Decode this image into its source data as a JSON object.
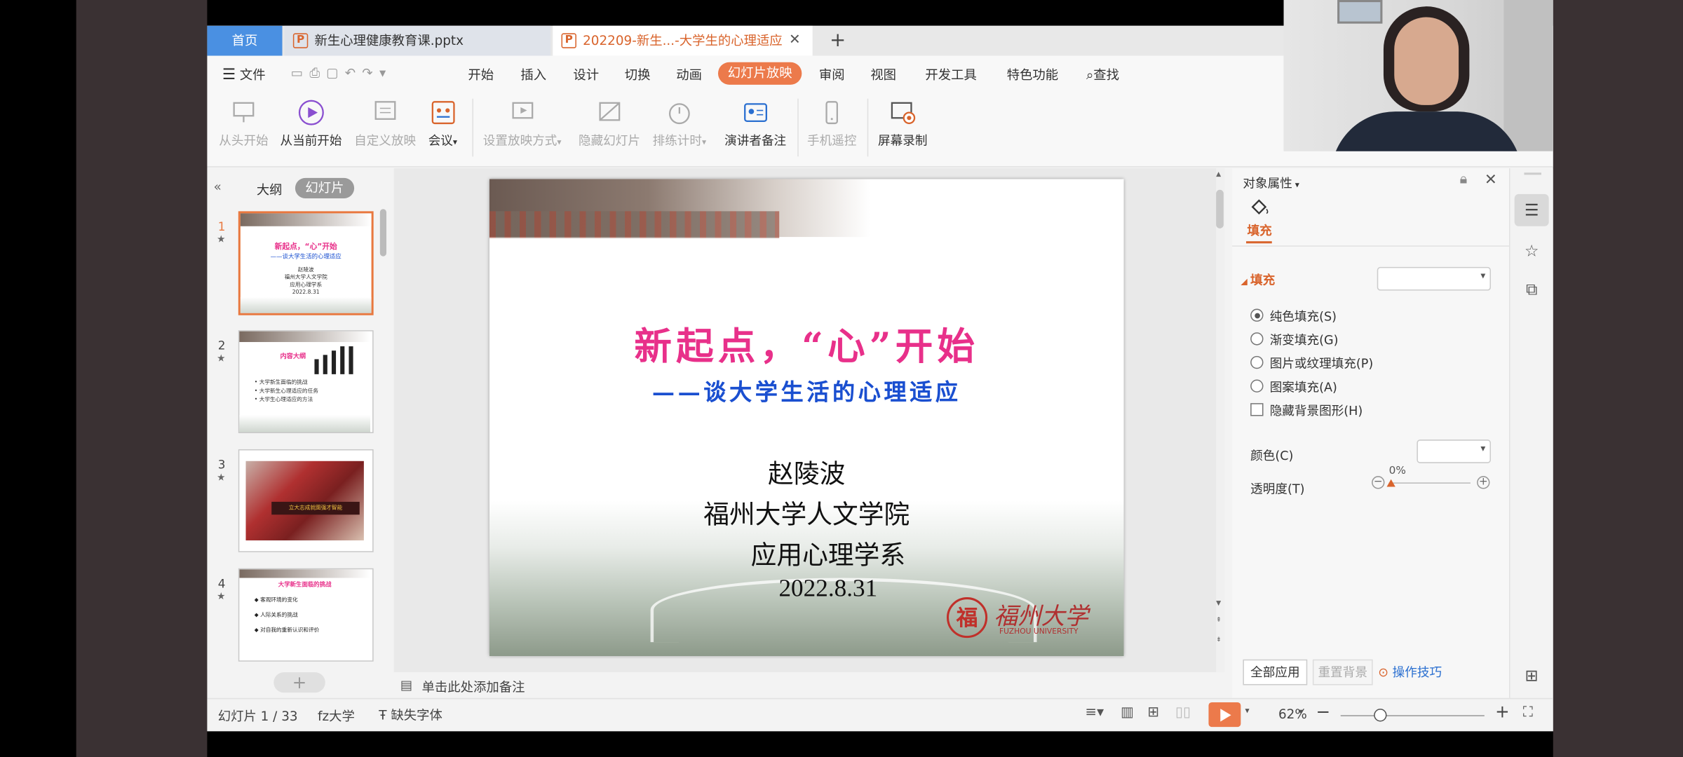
{
  "tabs": {
    "home": "首页",
    "doc1": "新生心理健康教育课.pptx",
    "doc2": "202209-新生...-大学生的心理适应",
    "close": "✕",
    "add": "+"
  },
  "menu": {
    "file": "文件",
    "items": [
      "开始",
      "插入",
      "设计",
      "切换",
      "动画",
      "幻灯片放映",
      "审阅",
      "视图",
      "开发工具",
      "特色功能"
    ],
    "search": "查找"
  },
  "ribbon": {
    "from_start": "从头开始",
    "from_current": "从当前开始",
    "custom_show": "自定义放映",
    "meeting": "会议",
    "setup_show": "设置放映方式",
    "hide_slide": "隐藏幻灯片",
    "rehearse": "排练计时",
    "presenter_notes": "演讲者备注",
    "phone_remote": "手机遥控",
    "screen_record": "屏幕录制"
  },
  "leftpane": {
    "outline": "大纲",
    "slides": "幻灯片",
    "thumbs": [
      {
        "num": "1",
        "title": "新起点，“心”开始",
        "subtitle": "——谈大学生活的心理适应",
        "lines": [
          "赵陵波",
          "福州大学人文学院",
          "应用心理学系",
          "2022.8.31"
        ]
      },
      {
        "num": "2",
        "title": "内容大纲",
        "lines": [
          "• 大学新生面临的挑战",
          "• 大学新生心理适应的任务",
          "• 大学生心理适应的方法"
        ]
      },
      {
        "num": "3",
        "banner": "立大志成就图强才智能"
      },
      {
        "num": "4",
        "title": "大学新生面临的挑战",
        "lines": [
          "◆ 客观环境的变化",
          "◆ 人际关系的挑战",
          "◆ 对自我的重新认识和评价"
        ]
      }
    ]
  },
  "slide": {
    "title": "新起点，“心”开始",
    "subtitle": "——谈大学生活的心理适应",
    "author": "赵陵波",
    "org": "福州大学人文学院",
    "dept": "应用心理学系",
    "date": "2022.8.31",
    "logo_cn": "福州大学",
    "logo_en": "FUZHOU UNIVERSITY",
    "seal": "福"
  },
  "notes": "单击此处添加备注",
  "rightpane": {
    "title": "对象属性",
    "tab_fill": "填充",
    "section_fill": "填充",
    "options": [
      "纯色填充(S)",
      "渐变填充(G)",
      "图片或纹理填充(P)",
      "图案填充(A)"
    ],
    "hide_bg": "隐藏背景图形(H)",
    "color_label": "颜色(C)",
    "transparency_label": "透明度(T)",
    "transparency_value": "0%",
    "apply_all": "全部应用",
    "reset_bg": "重置背景",
    "tips": "操作技巧"
  },
  "status": {
    "slide_counter": "幻灯片 1 / 33",
    "theme": "fz大学",
    "missing_font": "缺失字体",
    "zoom": "62%"
  },
  "colors": {
    "accent": "#ec7a4b",
    "title_pink": "#e8308a",
    "subtitle_blue": "#1a4fd0",
    "home_tab": "#4a90e2"
  }
}
